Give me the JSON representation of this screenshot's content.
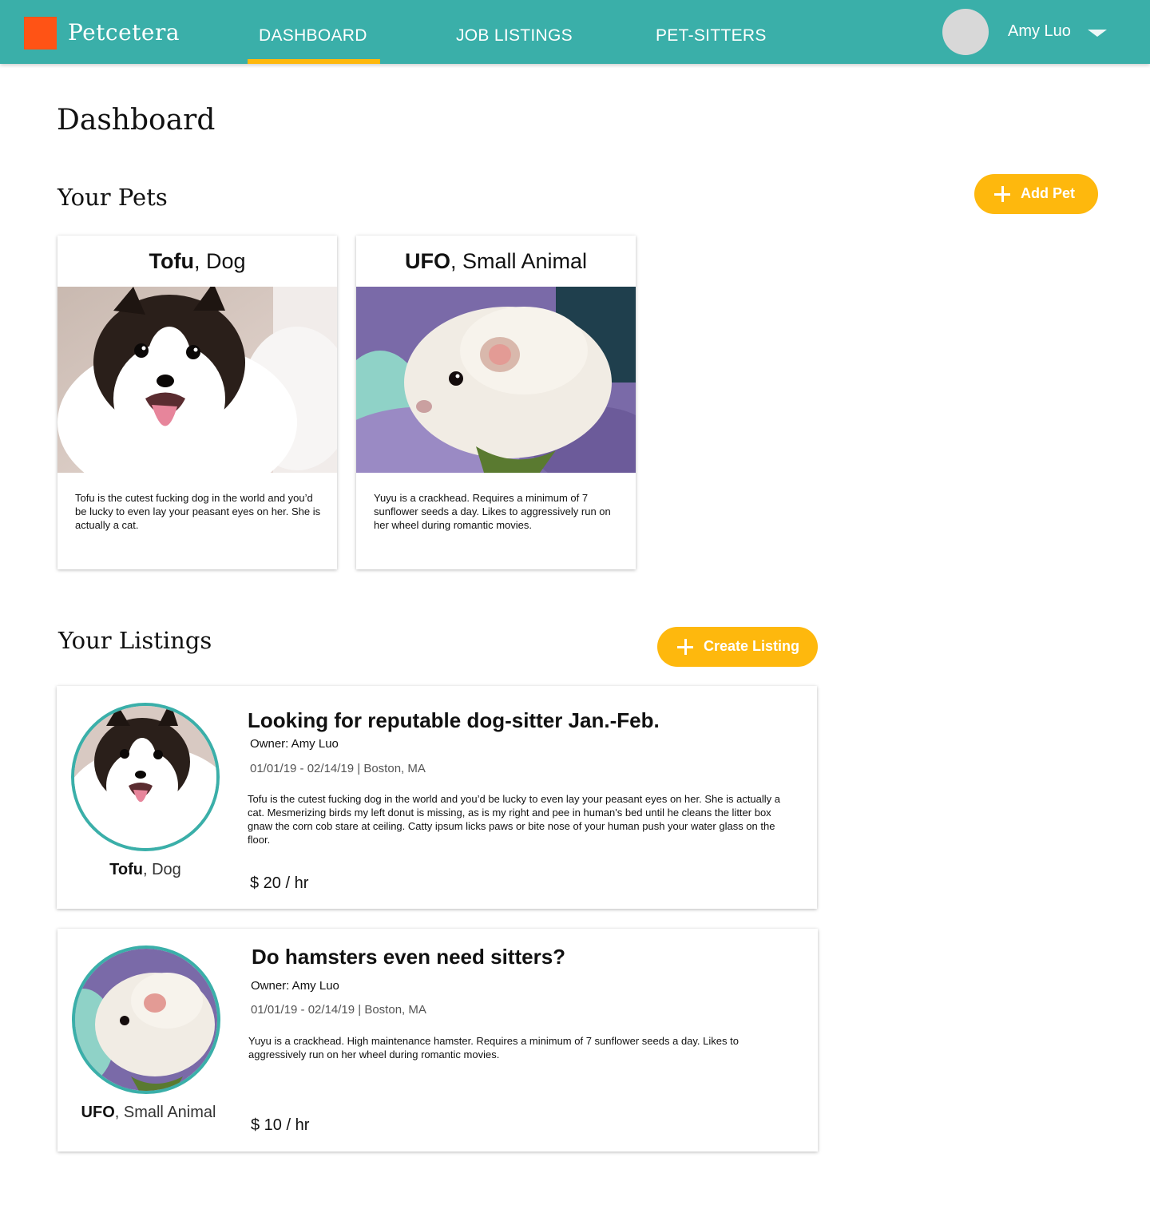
{
  "colors": {
    "teal": "#3aafa9",
    "logo": "#ff5315",
    "accent": "#feb80d",
    "avatar": "#d8d8d8"
  },
  "header": {
    "brand": "Petcetera",
    "nav": {
      "dashboard": "DASHBOARD",
      "job_listings": "JOB LISTINGS",
      "pet_sitters": "PET-SITTERS"
    },
    "active_tab": "DASHBOARD",
    "user_name": "Amy Luo"
  },
  "page": {
    "title": "Dashboard",
    "pets_heading": "Your Pets",
    "add_pet_label": "Add Pet",
    "listings_heading": "Your Listings",
    "create_listing_label": "Create Listing"
  },
  "pets": [
    {
      "name": "Tofu",
      "kind": ", Dog",
      "description": "Tofu is the cutest fucking dog in the world and you’d be lucky to even lay your peasant eyes on her. She is actually a cat."
    },
    {
      "name": "UFO",
      "kind": ", Small Animal",
      "description": "Yuyu is a crackhead. Requires a minimum of 7 sunflower seeds a day. Likes to aggressively run on her wheel during romantic movies."
    }
  ],
  "listings": [
    {
      "pet_name": "Tofu",
      "pet_kind": ", Dog",
      "title": "Looking for reputable dog-sitter Jan.-Feb.",
      "owner": "Owner: Amy Luo",
      "meta": "01/01/19 - 02/14/19  |  Boston, MA",
      "description": "Tofu is the cutest fucking dog in the world and you’d be lucky to even lay your peasant eyes on her. She is actually a cat. Mesmerizing birds my left donut is missing, as is my right and pee in human's bed until he cleans the litter box gnaw the corn cob stare at ceiling. Catty ipsum licks paws or bite nose of your human push your water glass on the floor.",
      "rate": "$ 20 / hr"
    },
    {
      "pet_name": "UFO",
      "pet_kind": ", Small Animal",
      "title": "Do hamsters even need sitters?",
      "owner": "Owner: Amy Luo",
      "meta": "01/01/19 - 02/14/19  |  Boston, MA",
      "description": "Yuyu is a crackhead. High maintenance hamster. Requires a minimum of 7 sunflower seeds a day. Likes to aggressively run on her wheel during romantic movies.",
      "rate": "$ 10 / hr"
    }
  ]
}
